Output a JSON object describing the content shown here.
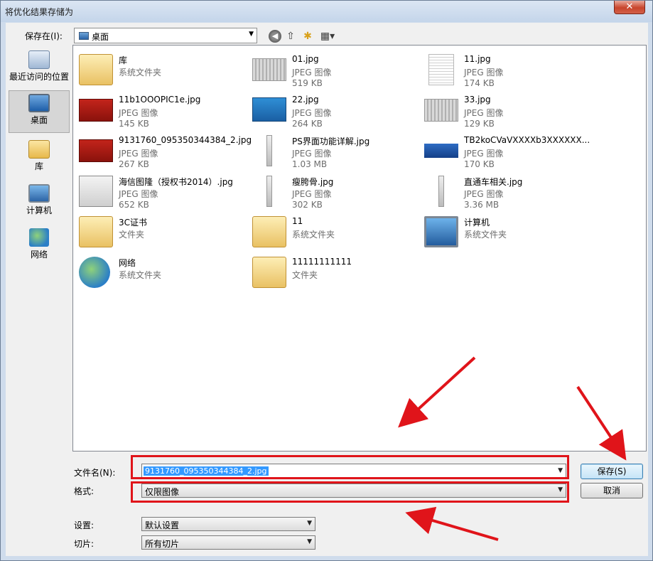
{
  "window": {
    "title": "将优化结果存储为",
    "close_glyph": "✕"
  },
  "toolbar": {
    "save_in_label": "保存在(I):",
    "save_in_value": "桌面",
    "back_glyph": "◀",
    "up_glyph": "⇧",
    "new_folder_glyph": "✱",
    "view_glyph": "▦▾"
  },
  "places": [
    {
      "label": "最近访问的位置",
      "icon": "recent-places-icon"
    },
    {
      "label": "桌面",
      "icon": "desktop-icon"
    },
    {
      "label": "库",
      "icon": "library-icon"
    },
    {
      "label": "计算机",
      "icon": "computer-icon"
    },
    {
      "label": "网络",
      "icon": "network-icon"
    }
  ],
  "files": [
    {
      "name": "库",
      "type": "系统文件夹",
      "size": ""
    },
    {
      "name": "01.jpg",
      "type": "JPEG 图像",
      "size": "519 KB"
    },
    {
      "name": "11.jpg",
      "type": "JPEG 图像",
      "size": "174 KB"
    },
    {
      "name": "11b1OOOPIC1e.jpg",
      "type": "JPEG 图像",
      "size": "145 KB"
    },
    {
      "name": "22.jpg",
      "type": "JPEG 图像",
      "size": "264 KB"
    },
    {
      "name": "33.jpg",
      "type": "JPEG 图像",
      "size": "129 KB"
    },
    {
      "name": "9131760_095350344384_2.jpg",
      "type": "JPEG 图像",
      "size": "267 KB"
    },
    {
      "name": "PS界面功能详解.jpg",
      "type": "JPEG 图像",
      "size": "1.03 MB"
    },
    {
      "name": "TB2koCVaVXXXXb3XXXXXX...",
      "type": "JPEG 图像",
      "size": "170 KB"
    },
    {
      "name": "海信图隆（授权书2014）.jpg",
      "type": "JPEG 图像",
      "size": "652 KB"
    },
    {
      "name": "瘦胯骨.jpg",
      "type": "JPEG 图像",
      "size": "302 KB"
    },
    {
      "name": "直通车相关.jpg",
      "type": "JPEG 图像",
      "size": "3.36 MB"
    },
    {
      "name": "3C证书",
      "type": "文件夹",
      "size": ""
    },
    {
      "name": "11",
      "type": "系统文件夹",
      "size": ""
    },
    {
      "name": "计算机",
      "type": "系统文件夹",
      "size": ""
    },
    {
      "name": "网络",
      "type": "系统文件夹",
      "size": ""
    },
    {
      "name": "11111111111",
      "type": "文件夹",
      "size": ""
    }
  ],
  "form": {
    "filename_label": "文件名(N):",
    "filename_value": "9131760_095350344384_2.jpg",
    "format_label": "格式:",
    "format_value": "仅限图像",
    "settings_label": "设置:",
    "settings_value": "默认设置",
    "slices_label": "切片:",
    "slices_value": "所有切片",
    "save_label": "保存(S)",
    "cancel_label": "取消",
    "dropdown_glyph": "▼"
  },
  "annotation_color": "#e0141a"
}
